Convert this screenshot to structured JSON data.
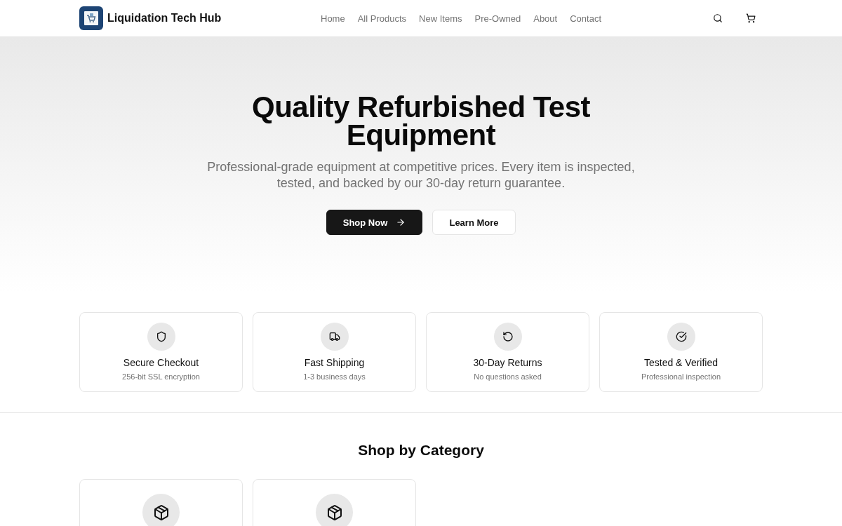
{
  "header": {
    "brand": "Liquidation Tech Hub",
    "nav": [
      "Home",
      "All Products",
      "New Items",
      "Pre-Owned",
      "About",
      "Contact"
    ]
  },
  "hero": {
    "title": "Quality Refurbished Test Equipment",
    "subtitle": "Professional-grade equipment at competitive prices. Every item is inspected, tested, and backed by our 30-day return guarantee.",
    "buttons": [
      {
        "label": "Shop Now",
        "kind": "primary"
      },
      {
        "label": "Learn More",
        "kind": "secondary"
      }
    ]
  },
  "features": [
    {
      "title": "Secure Checkout",
      "subtitle": "256-bit SSL encryption"
    },
    {
      "title": "Fast Shipping",
      "subtitle": "1-3 business days"
    },
    {
      "title": "30-Day Returns",
      "subtitle": "No questions asked"
    },
    {
      "title": "Tested & Verified",
      "subtitle": "Professional inspection"
    }
  ],
  "categories": {
    "title": "Shop by Category",
    "cards": [
      {
        "kind": "category"
      },
      {
        "kind": "category"
      }
    ]
  }
}
